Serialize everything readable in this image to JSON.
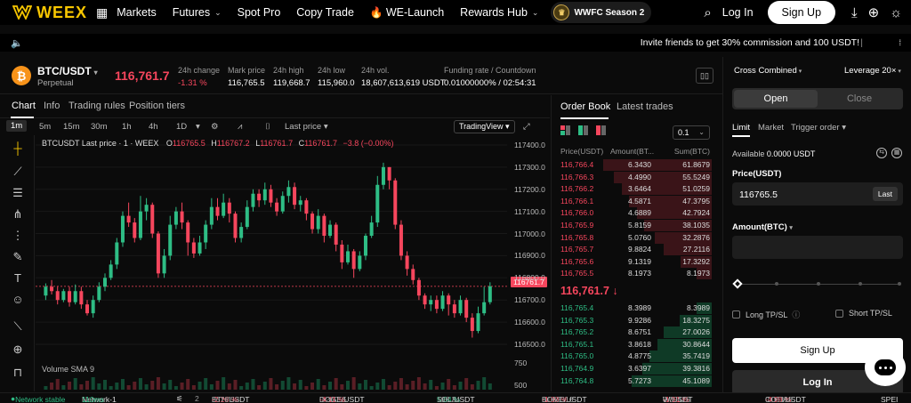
{
  "nav": {
    "logo": "WEEX",
    "items": [
      "Markets",
      "Futures",
      "Spot Pro",
      "Copy Trade",
      "WE-Launch",
      "Rewards Hub"
    ],
    "season": "WWFC Season 2",
    "login": "Log In",
    "signup": "Sign Up",
    "icons": [
      "grid-icon",
      "search-icon",
      "download-icon",
      "globe-icon",
      "theme-icon"
    ]
  },
  "announcement": {
    "text": "Invite friends to get 30% commission and 100 USDT!"
  },
  "header": {
    "pair": "BTC/USDT",
    "type": "Perpetual",
    "price": "116,761.7",
    "stats": [
      {
        "label": "24h change",
        "value": "-1.31 %"
      },
      {
        "label": "Mark price",
        "value": "116,765.5"
      },
      {
        "label": "24h high",
        "value": "119,668.7"
      },
      {
        "label": "24h low",
        "value": "115,960.0"
      },
      {
        "label": "24h vol.",
        "value": "18,607,613,619 USDT"
      },
      {
        "label": "Funding rate / Countdown",
        "value": "0.01000000% / 02:54:31"
      }
    ]
  },
  "chart_tabs": [
    "Chart",
    "Info",
    "Trading rules",
    "Position tiers"
  ],
  "timeframes": [
    "1m",
    "5m",
    "15m",
    "30m",
    "1h",
    "4h",
    "1D"
  ],
  "chart_toolbar": {
    "price_mode": "Last price",
    "view": "TradingView"
  },
  "chart_legend": {
    "title": "BTCUSDT Last price · 1 · WEEX",
    "o_label": "O",
    "o": "116765.5",
    "h_label": "H",
    "h": "116767.2",
    "l_label": "L",
    "l": "116761.7",
    "c_label": "C",
    "c": "116761.7",
    "chg": "−3.8 (−0.00%)"
  },
  "volume_label": "Volume SMA 9",
  "current_price_tag": "116761.7",
  "chart_data": {
    "type": "candlestick",
    "y_ticks": [
      "117400.0",
      "117300.0",
      "117200.0",
      "117100.0",
      "117000.0",
      "116900.0",
      "116800.0",
      "116700.0",
      "116600.0",
      "116500.0",
      "750",
      "500"
    ],
    "ylim": [
      116440,
      117420
    ],
    "candles": [
      [
        116720,
        116760,
        116700,
        116775
      ],
      [
        116760,
        116740,
        116725,
        116790
      ],
      [
        116740,
        116700,
        116680,
        116760
      ],
      [
        116700,
        116740,
        116690,
        116750
      ],
      [
        116740,
        116690,
        116670,
        116760
      ],
      [
        116690,
        116740,
        116680,
        116770
      ],
      [
        116740,
        116680,
        116660,
        116760
      ],
      [
        116680,
        116640,
        116630,
        116700
      ],
      [
        116640,
        116700,
        116620,
        116720
      ],
      [
        116700,
        116760,
        116690,
        116780
      ],
      [
        116760,
        116800,
        116740,
        116820
      ],
      [
        116800,
        116860,
        116790,
        116880
      ],
      [
        116860,
        116960,
        116840,
        116980
      ],
      [
        116960,
        117080,
        116940,
        117100
      ],
      [
        117080,
        117050,
        117030,
        117140
      ],
      [
        117050,
        116980,
        116960,
        117070
      ],
      [
        116980,
        117100,
        116970,
        117170
      ],
      [
        117100,
        117130,
        117060,
        117160
      ],
      [
        117130,
        117000,
        116980,
        117140
      ],
      [
        117000,
        116820,
        116800,
        117010
      ],
      [
        116820,
        116900,
        116800,
        116930
      ],
      [
        116900,
        117040,
        116880,
        117080
      ],
      [
        117040,
        117100,
        117020,
        117120
      ],
      [
        117100,
        117050,
        117020,
        117140
      ],
      [
        117050,
        116960,
        116900,
        117060
      ],
      [
        116960,
        116910,
        116890,
        116980
      ],
      [
        116910,
        116960,
        116900,
        116990
      ],
      [
        116960,
        117040,
        116930,
        117060
      ],
      [
        117040,
        117120,
        117020,
        117160
      ],
      [
        117120,
        117080,
        117060,
        117160
      ],
      [
        117080,
        117140,
        117070,
        117180
      ],
      [
        117140,
        117090,
        117050,
        117160
      ],
      [
        117090,
        116980,
        116960,
        117100
      ],
      [
        116980,
        117030,
        116960,
        117050
      ],
      [
        117030,
        117120,
        117020,
        117150
      ],
      [
        117120,
        117180,
        117100,
        117200
      ],
      [
        117180,
        117150,
        117120,
        117200
      ],
      [
        117150,
        117200,
        117130,
        117230
      ],
      [
        117200,
        117140,
        117120,
        117220
      ],
      [
        117140,
        117100,
        117080,
        117160
      ],
      [
        117100,
        117170,
        117090,
        117190
      ],
      [
        117170,
        117210,
        117140,
        117240
      ],
      [
        117210,
        117130,
        117110,
        117230
      ],
      [
        117130,
        117150,
        117100,
        117170
      ],
      [
        117150,
        117090,
        117060,
        117160
      ],
      [
        117090,
        117020,
        117000,
        117100
      ],
      [
        117020,
        117080,
        117000,
        117110
      ],
      [
        117080,
        116990,
        116960,
        117090
      ],
      [
        116990,
        117040,
        116980,
        117060
      ],
      [
        117040,
        116950,
        116920,
        117050
      ],
      [
        116950,
        116870,
        116840,
        116970
      ],
      [
        116870,
        116920,
        116860,
        116950
      ],
      [
        116920,
        116840,
        116800,
        116930
      ],
      [
        116840,
        116900,
        116830,
        116920
      ],
      [
        116900,
        116990,
        116880,
        117000
      ],
      [
        116990,
        117050,
        116980,
        117080
      ],
      [
        117050,
        117220,
        117030,
        117260
      ],
      [
        117220,
        117300,
        117200,
        117320
      ],
      [
        117300,
        117240,
        117200,
        117300
      ],
      [
        117240,
        117040,
        117020,
        117250
      ],
      [
        117040,
        116900,
        116880,
        117060
      ],
      [
        116900,
        116840,
        116810,
        116920
      ],
      [
        116840,
        116790,
        116770,
        116860
      ],
      [
        116790,
        116720,
        116700,
        116800
      ],
      [
        116720,
        116680,
        116660,
        116730
      ],
      [
        116680,
        116700,
        116650,
        116720
      ],
      [
        116700,
        116660,
        116640,
        116720
      ],
      [
        116660,
        116720,
        116650,
        116740
      ],
      [
        116720,
        116680,
        116630,
        116730
      ],
      [
        116680,
        116640,
        116620,
        116700
      ],
      [
        116640,
        116700,
        116630,
        116720
      ],
      [
        116700,
        116620,
        116600,
        116710
      ],
      [
        116620,
        116560,
        116530,
        116640
      ],
      [
        116560,
        116640,
        116550,
        116670
      ],
      [
        116640,
        116690,
        116630,
        116760
      ],
      [
        116690,
        116761.7,
        116680,
        116780
      ]
    ]
  },
  "orderbook": {
    "tabs": [
      "Order Book",
      "Latest trades"
    ],
    "precision": "0.1",
    "headers": [
      "Price(USDT)",
      "Amount(BT...",
      "Sum(BTC)"
    ],
    "asks": [
      [
        "116,766.4",
        "6.3430",
        "61.8679",
        0.95
      ],
      [
        "116,766.3",
        "4.4990",
        "55.5249",
        0.86
      ],
      [
        "116,766.2",
        "3.6464",
        "51.0259",
        0.79
      ],
      [
        "116,766.1",
        "4.5871",
        "47.3795",
        0.73
      ],
      [
        "116,766.0",
        "4.6889",
        "42.7924",
        0.66
      ],
      [
        "116,765.9",
        "5.8159",
        "38.1035",
        0.59
      ],
      [
        "116,765.8",
        "5.0760",
        "32.2876",
        0.5
      ],
      [
        "116,765.7",
        "9.8824",
        "27.2116",
        0.42
      ],
      [
        "116,765.6",
        "9.1319",
        "17.3292",
        0.27
      ],
      [
        "116,765.5",
        "8.1973",
        "8.1973",
        0.13
      ]
    ],
    "mid_price": "116,761.7",
    "mid_sub": "116,765.5",
    "bids": [
      [
        "116,765.4",
        "8.3989",
        "8.3989",
        0.13
      ],
      [
        "116,765.3",
        "9.9286",
        "18.3275",
        0.28
      ],
      [
        "116,765.2",
        "8.6751",
        "27.0026",
        0.42
      ],
      [
        "116,765.1",
        "3.8618",
        "30.8644",
        0.48
      ],
      [
        "116,765.0",
        "4.8775",
        "35.7419",
        0.55
      ],
      [
        "116,764.9",
        "3.6397",
        "39.3816",
        0.61
      ],
      [
        "116,764.8",
        "5.7273",
        "45.1089",
        0.7
      ]
    ]
  },
  "trade": {
    "margin_mode": "Cross Combined",
    "leverage": "Leverage 20×",
    "open": "Open",
    "close": "Close",
    "order_types": [
      "Limit",
      "Market",
      "Trigger order"
    ],
    "available_label": "Available",
    "available_value": "0.0000 USDT",
    "price_label": "Price(USDT)",
    "price_value": "116765.5",
    "last_btn": "Last",
    "amount_label": "Amount(BTC)",
    "long_tpsl": "Long TP/SL",
    "short_tpsl": "Short TP/SL",
    "signup": "Sign Up",
    "login": "Log In"
  },
  "footer": {
    "network_status": "Network stable",
    "network": "Network-1",
    "latency": "110ms",
    "count": "2",
    "tickers": [
      {
        "pair": "ETH/USDT",
        "chg": "-2.26 %",
        "price": "3676.52"
      },
      {
        "pair": "DOGE/USDT",
        "chg": "-4.11 %",
        "price": "0.26055"
      },
      {
        "pair": "SOL/USDT",
        "chg": "5.64 %",
        "price": "196.24"
      },
      {
        "pair": "BOME/USDT",
        "chg": "-1.03 %",
        "price": "0.002316"
      },
      {
        "pair": "W/USDT",
        "chg": "-1.91 %",
        "price": "0.09426"
      },
      {
        "pair": "COTI/USDT",
        "chg": "-4.98 %",
        "price": "0.06398"
      },
      {
        "pair": "SPEI",
        "chg": "",
        "price": ""
      }
    ]
  }
}
